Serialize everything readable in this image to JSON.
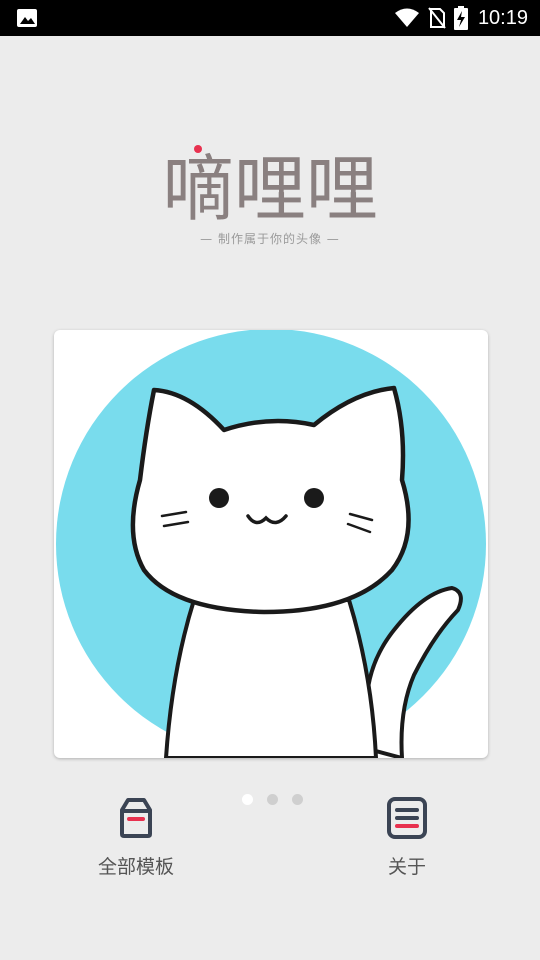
{
  "app": {
    "title": "嘀哩哩",
    "tagline": "— 制作属于你的头像 —"
  },
  "status_bar": {
    "time": "10:19",
    "icons": [
      "image-icon",
      "wifi-icon",
      "no-sim-icon",
      "battery-charging-icon"
    ]
  },
  "carousel": {
    "page_count": 3,
    "active_index": 0,
    "image": "cat-avatar"
  },
  "bottom_nav": {
    "templates_label": "全部模板",
    "about_label": "关于"
  },
  "colors": {
    "background": "#ececec",
    "accent": "#e8314f",
    "circle": "#79dced",
    "icon": "#3b4454",
    "logo_text": "#8a8080"
  }
}
